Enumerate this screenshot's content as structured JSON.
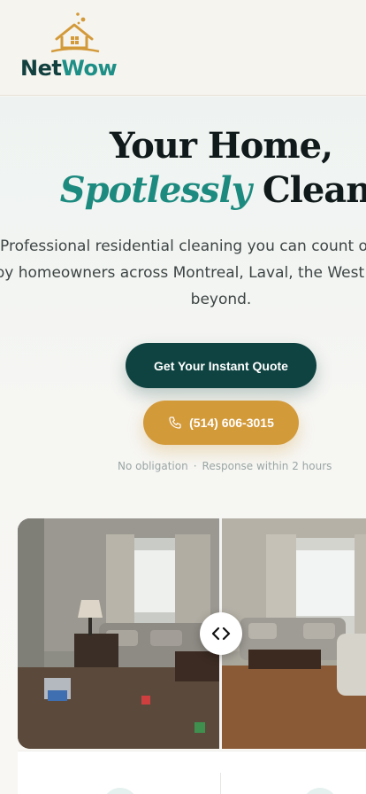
{
  "brand": {
    "name_part1": "Net",
    "name_part2": "Wow",
    "colors": {
      "dark": "#12403f",
      "teal": "#1d8f86",
      "gold": "#d39a3a"
    }
  },
  "hero": {
    "headline_line1": "Your Home,",
    "headline_accent": "Spotlessly",
    "headline_line2_rest": " Clean.",
    "subtext": "Professional residential cleaning you can count on. Trusted by homeowners across Montreal, Laval, the West Island and beyond.",
    "cta_quote": "Get Your Instant Quote",
    "cta_phone": "(514) 606-3015",
    "reassure_1": "No obligation",
    "reassure_sep": "·",
    "reassure_2": "Response within 2 hours"
  },
  "compare": {
    "split_fraction": 0.55,
    "handle_icon": "chevron-left-right-icon"
  }
}
